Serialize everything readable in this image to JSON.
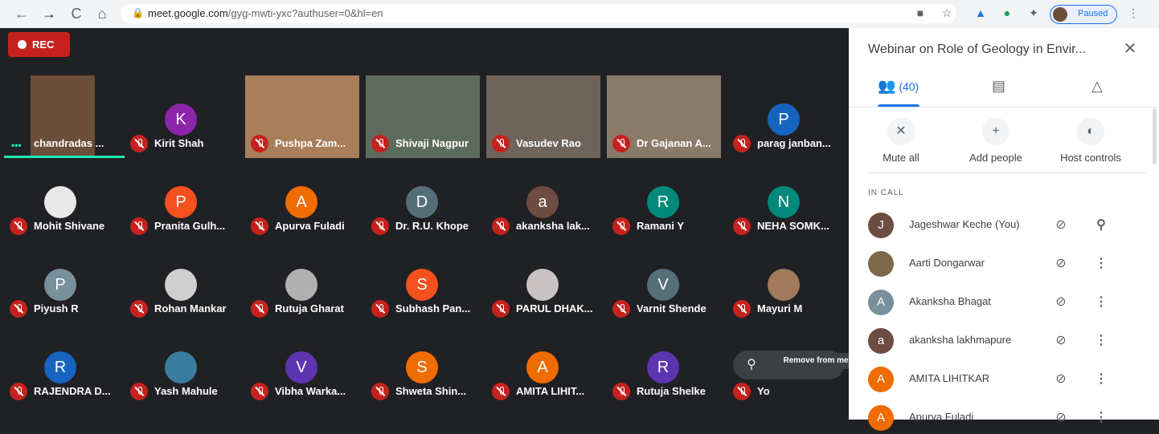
{
  "browser": {
    "url_host": "meet.google.com",
    "url_path": "/gyg-mwti-yxc?authuser=0&hl=en",
    "profile_status": "Paused",
    "nav": {
      "back": "←",
      "forward": "→",
      "reload": "C",
      "home": "⌂"
    }
  },
  "meeting": {
    "rec_label": "REC",
    "participants": [
      {
        "name": "chandradas ...",
        "initial": "",
        "color": "#6b4f3a",
        "mode": "video",
        "active": true
      },
      {
        "name": "Kirit Shah",
        "initial": "K",
        "color": "#8e24aa",
        "mode": "avatar"
      },
      {
        "name": "Pushpa Zam...",
        "initial": "",
        "color": "#a97e5a",
        "mode": "video"
      },
      {
        "name": "Shivaji Nagpur",
        "initial": "",
        "color": "#5d6b5e",
        "mode": "video"
      },
      {
        "name": "Vasudev Rao",
        "initial": "",
        "color": "#6e6459",
        "mode": "video"
      },
      {
        "name": "Dr Gajanan A...",
        "initial": "",
        "color": "#8a7a6a",
        "mode": "video"
      },
      {
        "name": "parag janban...",
        "initial": "P",
        "color": "#1565c0",
        "mode": "avatar"
      },
      {
        "name": "Mohit Shivane",
        "initial": "",
        "color": "#e8e8e8",
        "mode": "photo"
      },
      {
        "name": "Pranita Gulh...",
        "initial": "P",
        "color": "#f4511e",
        "mode": "avatar"
      },
      {
        "name": "Apurva Fuladi",
        "initial": "A",
        "color": "#ef6c00",
        "mode": "avatar"
      },
      {
        "name": "Dr. R.U. Khope",
        "initial": "D",
        "color": "#546e7a",
        "mode": "avatar"
      },
      {
        "name": "akanksha lak...",
        "initial": "a",
        "color": "#6d4c41",
        "mode": "avatar"
      },
      {
        "name": "Ramani Y",
        "initial": "R",
        "color": "#00897b",
        "mode": "avatar"
      },
      {
        "name": "NEHA SOMK...",
        "initial": "N",
        "color": "#00897b",
        "mode": "avatar"
      },
      {
        "name": "Piyush R",
        "initial": "P",
        "color": "#78909c",
        "mode": "avatar"
      },
      {
        "name": "Rohan Mankar",
        "initial": "",
        "color": "#cfcfcf",
        "mode": "photo"
      },
      {
        "name": "Rutuja Gharat",
        "initial": "",
        "color": "#b0b0b0",
        "mode": "photo"
      },
      {
        "name": "Subhash Pan...",
        "initial": "S",
        "color": "#f4511e",
        "mode": "avatar"
      },
      {
        "name": "PARUL DHAK...",
        "initial": "",
        "color": "#c8c2c2",
        "mode": "photo"
      },
      {
        "name": "Varnit Shende",
        "initial": "V",
        "color": "#546e7a",
        "mode": "avatar"
      },
      {
        "name": "Mayuri M",
        "initial": "",
        "color": "#a07a5a",
        "mode": "photo"
      },
      {
        "name": "RAJENDRA D...",
        "initial": "R",
        "color": "#1565c0",
        "mode": "avatar"
      },
      {
        "name": "Yash Mahule",
        "initial": "",
        "color": "#3a7d9e",
        "mode": "photo"
      },
      {
        "name": "Vibha Warka...",
        "initial": "V",
        "color": "#5e35b1",
        "mode": "avatar"
      },
      {
        "name": "Shweta Shin...",
        "initial": "S",
        "color": "#ef6c00",
        "mode": "avatar"
      },
      {
        "name": "AMITA LIHIT...",
        "initial": "A",
        "color": "#ef6c00",
        "mode": "avatar"
      },
      {
        "name": "Rutuja Shelke",
        "initial": "R",
        "color": "#5e35b1",
        "mode": "avatar"
      },
      {
        "name": "Yo",
        "initial": "",
        "color": "#202124",
        "mode": "hidden"
      }
    ],
    "tooltip": "Remove from meeting"
  },
  "panel": {
    "title": "Webinar on Role of Geology in Envir...",
    "people_count": "(40)",
    "actions": [
      {
        "label": "Mute all",
        "icon": "mic-off-icon"
      },
      {
        "label": "Add people",
        "icon": "add-person-icon"
      },
      {
        "label": "Host controls",
        "icon": "toggle-icon"
      }
    ],
    "section": "IN CALL",
    "people": [
      {
        "name": "Jageshwar Keche (You)",
        "initial": "J",
        "color": "#6d4c41",
        "action": "pin"
      },
      {
        "name": "Aarti Dongarwar",
        "initial": "",
        "color": "#7a6a4a",
        "action": "more"
      },
      {
        "name": "Akanksha Bhagat",
        "initial": "A",
        "color": "#78909c",
        "action": "more"
      },
      {
        "name": "akanksha lakhmapure",
        "initial": "a",
        "color": "#6d4c41",
        "action": "more"
      },
      {
        "name": "AMITA LIHITKAR",
        "initial": "A",
        "color": "#ef6c00",
        "action": "more"
      },
      {
        "name": "Apurva Fuladi",
        "initial": "A",
        "color": "#ef6c00",
        "action": "more"
      }
    ]
  }
}
